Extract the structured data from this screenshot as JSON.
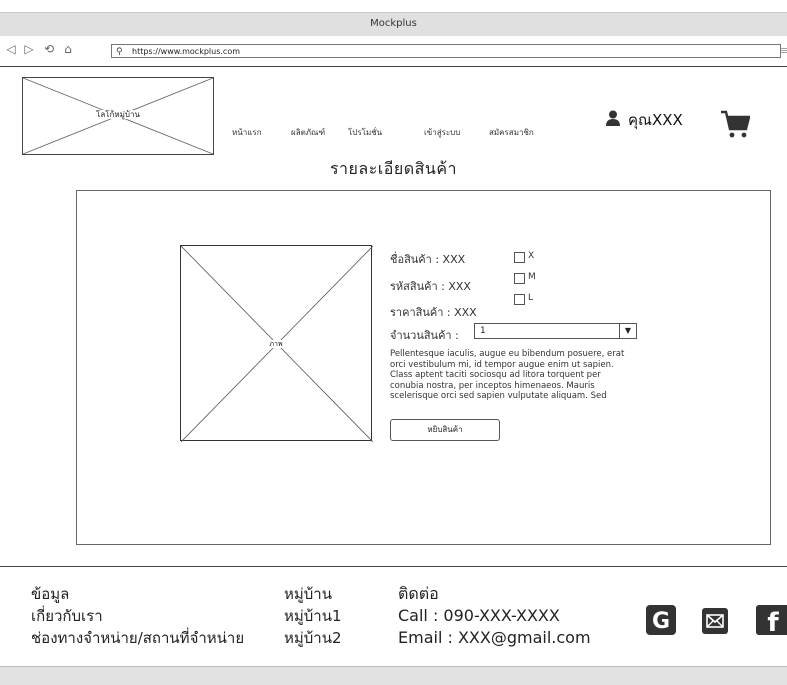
{
  "window": {
    "title": "Mockplus"
  },
  "browser": {
    "url": "https://www.mockplus.com"
  },
  "header": {
    "logo_text": "โลโก้หมู่บ้าน",
    "nav": [
      "หน้าแรก",
      "ผลิตภัณฑ์",
      "โปรโมชั่น",
      "เข้าสู่ระบบ",
      "สมัครสมาชิก"
    ],
    "user_label": "คุณXXX"
  },
  "page": {
    "title": "รายละเอียดสินค้า"
  },
  "product": {
    "image_label": "ภาพ",
    "name": "ชื่อสินค้า : XXX",
    "code": "รหัสสินค้า : XXX",
    "price": "ราคาสินค้า : XXX",
    "quantity_label": "จำนวนสินค้า :",
    "quantity_value": "1",
    "sizes": [
      "X",
      "M",
      "L"
    ],
    "description": "Pellentesque iaculis, augue eu bibendum posuere, erat orci vestibulum mi, id tempor augue enim ut sapien. Class aptent taciti sociosqu ad litora torquent per conubia nostra, per inceptos himenaeos. Mauris scelerisque orci sed sapien vulputate aliquam. Sed",
    "add_button": "หยิบสินค้า"
  },
  "footer": {
    "col1": [
      "ข้อมูล",
      "เกี่ยวกับเรา",
      "ช่องทางจำหน่าย/สถานที่จำหน่าย"
    ],
    "col2": [
      "หมู่บ้าน",
      "หมู่บ้าน1",
      "หมู่บ้าน2"
    ],
    "col3": [
      "ติดต่อ",
      "Call : 090-XXX-XXXX",
      "Email : XXX@gmail.com"
    ],
    "social_icons": [
      "google-icon",
      "mail-icon",
      "facebook-icon"
    ]
  }
}
